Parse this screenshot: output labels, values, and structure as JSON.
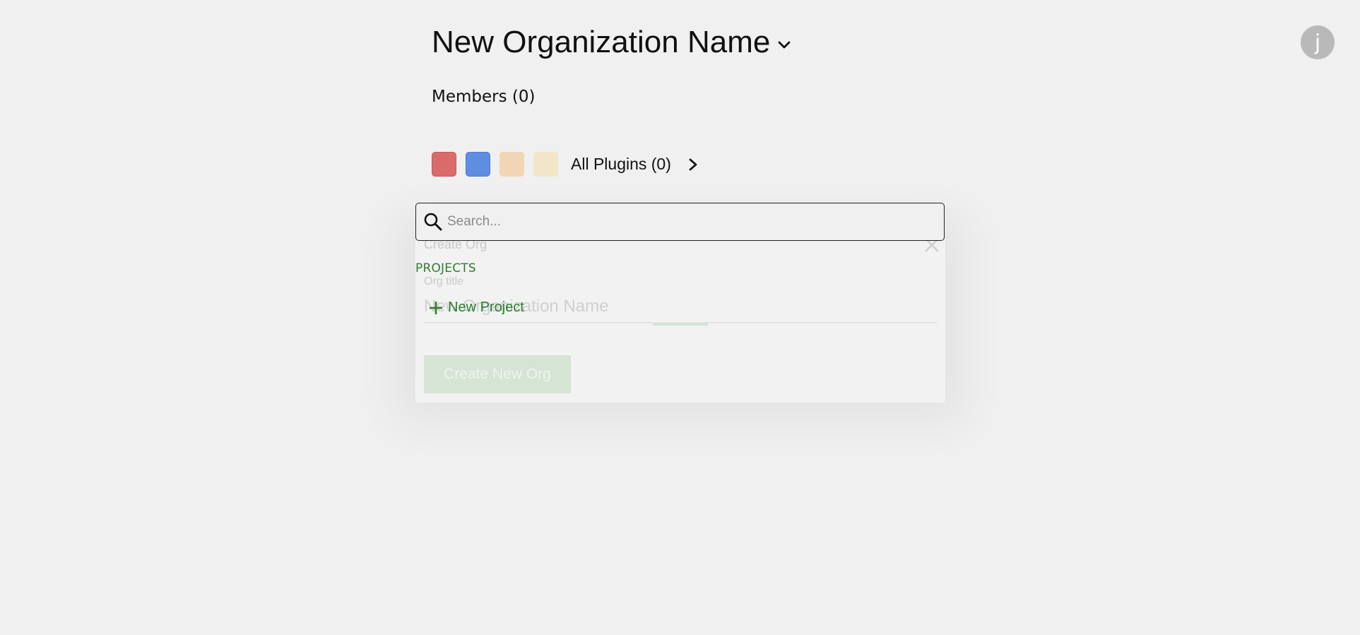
{
  "header": {
    "org_name": "New Organization Name",
    "avatar_initial": "j"
  },
  "members": {
    "label": "Members (0)"
  },
  "plugins": {
    "label": "All Plugins (0)",
    "swatches": [
      "#d96b6b",
      "#5f8de0",
      "#f0d6b5",
      "#f1e7c8"
    ]
  },
  "modal": {
    "title": "Create Org",
    "field_label": "Org title",
    "field_value": "New Organization Name",
    "submit_label": "Create New Org"
  },
  "palette": {
    "search_placeholder": "Search...",
    "section_label": "PROJECTS",
    "new_project_label": "New Project",
    "accent_color": "#2e7d32"
  }
}
